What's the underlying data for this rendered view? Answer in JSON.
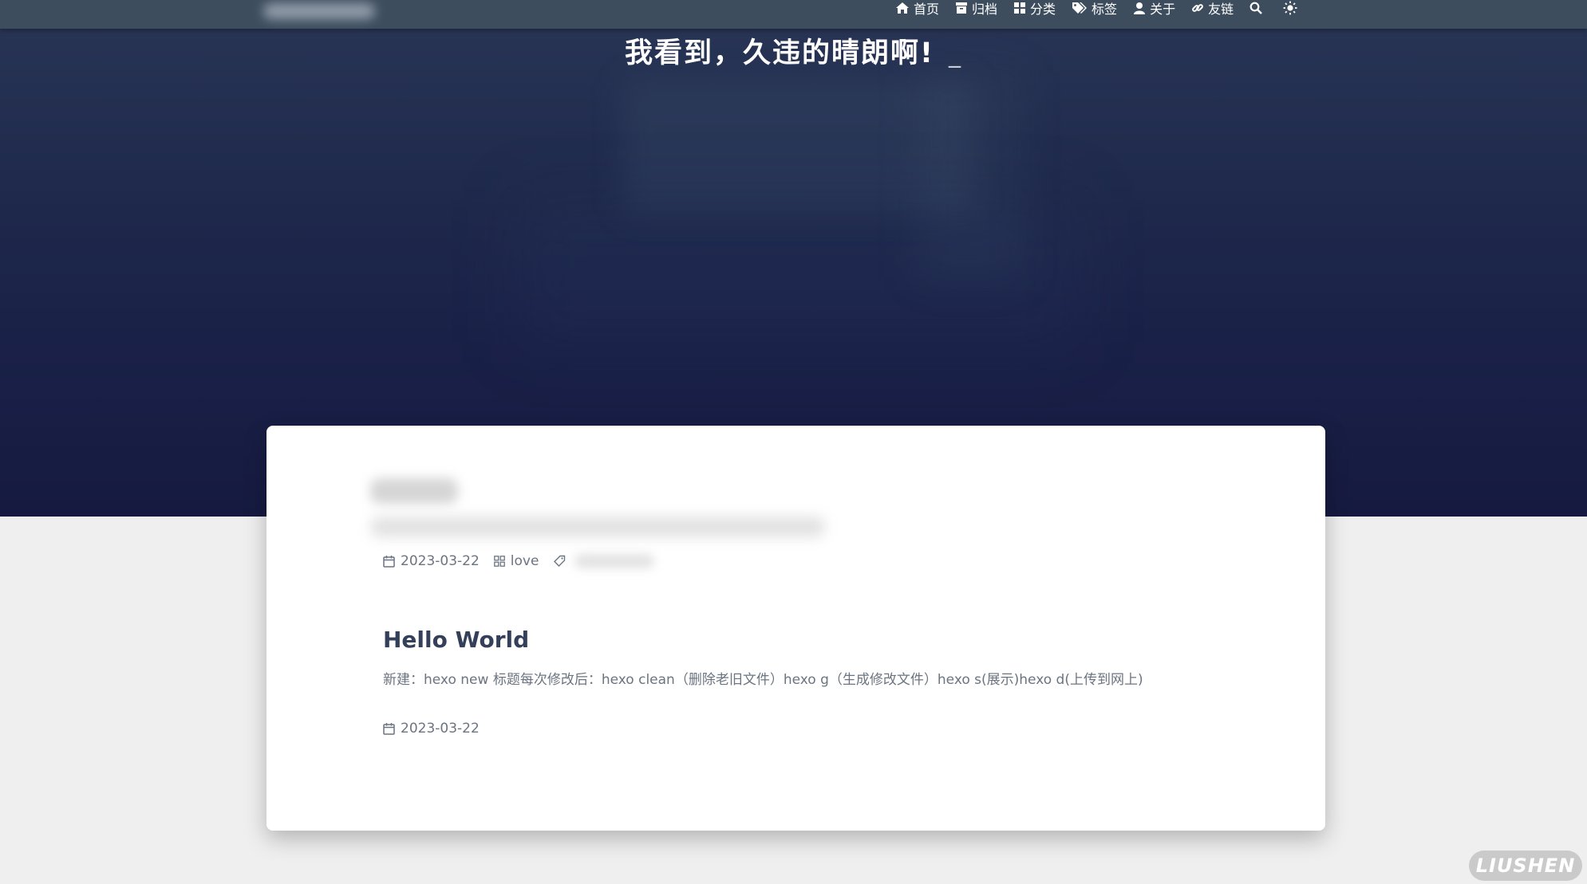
{
  "nav": {
    "items": [
      {
        "label": "首页",
        "icon": "home-icon"
      },
      {
        "label": "归档",
        "icon": "archive-icon"
      },
      {
        "label": "分类",
        "icon": "categories-icon"
      },
      {
        "label": "标签",
        "icon": "tags-icon"
      },
      {
        "label": "关于",
        "icon": "user-icon"
      },
      {
        "label": "友链",
        "icon": "link-icon"
      }
    ],
    "search_icon": "search-icon",
    "theme_icon": "sun-icon"
  },
  "hero": {
    "subtitle": "我看到，久违的晴朗啊!",
    "cursor": "_"
  },
  "card": {
    "meta": {
      "date": "2023-03-22",
      "category": "love"
    },
    "post": {
      "title": "Hello World",
      "excerpt": "新建：hexo new 标题每次修改后：hexo clean（删除老旧文件）hexo g（生成修改文件）hexo s(展示)hexo d(上传到网上)",
      "date": "2023-03-22"
    }
  },
  "watermark": "LIUSHEN",
  "colors": {
    "navbar": "#3d4d5e",
    "hero_top": "#2a3656",
    "hero_bottom": "#161a40",
    "page_bg": "#efefef",
    "card_bg": "#ffffff",
    "post_title": "#34405a",
    "meta_text": "#6b7480"
  }
}
